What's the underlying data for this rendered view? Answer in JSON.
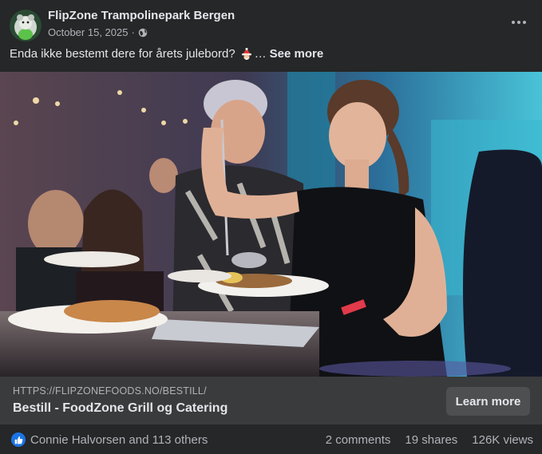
{
  "post": {
    "page_name": "FlipZone Trampolinepark Bergen",
    "date": "October 15, 2025",
    "separator": "·",
    "caption": "Enda ikke bestemt dere for årets julebord?",
    "caption_ellipsis": "…",
    "see_more": "See more",
    "icons": {
      "avatar": "mascot-avatar",
      "audience": "globe-icon",
      "menu": "more-options-icon",
      "emoji": "santa-emoji-icon",
      "reaction": "like-icon"
    }
  },
  "link": {
    "url": "HTTPS://FLIPZONEFOODS.NO/BESTILL/",
    "title": "Bestill - FoodZone Grill og Catering",
    "cta": "Learn more"
  },
  "footer": {
    "reactions": "Connie Halvorsen and 113 others",
    "comments": "2 comments",
    "shares": "19 shares",
    "views": "126K views"
  },
  "colors": {
    "background": "#252728",
    "link_panel": "#3a3b3c",
    "button": "#4e4f50",
    "like_blue": "#1b74e4"
  }
}
